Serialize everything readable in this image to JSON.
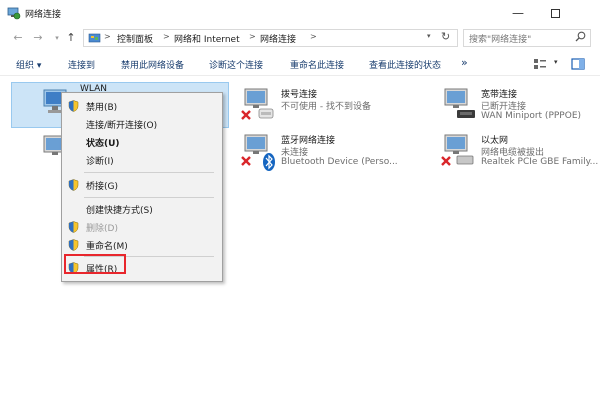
{
  "window": {
    "title": "网络连接",
    "minimize_glyph": "—"
  },
  "nav": {
    "back_glyph": "←",
    "forward_glyph": "→",
    "recent_glyph": "▾",
    "up_glyph": "↑"
  },
  "address": {
    "crumbs": [
      "控制面板",
      "网络和 Internet",
      "网络连接"
    ],
    "separator": ">",
    "dropdown_glyph": "▾",
    "refresh_glyph": "↻"
  },
  "search": {
    "placeholder": "搜索\"网络连接\""
  },
  "commands": {
    "organize": "组织 ▾",
    "connect_to": "连接到",
    "disable_device": "禁用此网络设备",
    "diagnose": "诊断这个连接",
    "rename": "重命名此连接",
    "view_status": "查看此连接的状态",
    "more": "»",
    "view_dropdown_glyph": "▾"
  },
  "connections": [
    {
      "name": "WLAN",
      "status": "",
      "device": ""
    },
    {
      "name": "拨号连接",
      "status": "不可使用 - 找不到设备",
      "device": ""
    },
    {
      "name": "宽带连接",
      "status": "已断开连接",
      "device": "WAN Miniport (PPPOE)"
    },
    {
      "name": "",
      "status": "",
      "device": ""
    },
    {
      "name": "蓝牙网络连接",
      "status": "未连接",
      "device": "Bluetooth Device (Perso..."
    },
    {
      "name": "以太网",
      "status": "网络电缆被拔出",
      "device": "Realtek PCIe GBE Family..."
    }
  ],
  "context_menu": {
    "items": [
      {
        "label": "禁用(B)",
        "shield": true,
        "bold": false,
        "disabled": false
      },
      {
        "label": "连接/断开连接(O)",
        "shield": false,
        "bold": false,
        "disabled": false
      },
      {
        "label": "状态(U)",
        "shield": false,
        "bold": true,
        "disabled": false
      },
      {
        "label": "诊断(I)",
        "shield": false,
        "bold": false,
        "disabled": false
      },
      {
        "label": "桥接(G)",
        "shield": true,
        "bold": false,
        "disabled": false
      },
      {
        "label": "创建快捷方式(S)",
        "shield": false,
        "bold": false,
        "disabled": false
      },
      {
        "label": "删除(D)",
        "shield": true,
        "bold": false,
        "disabled": true
      },
      {
        "label": "重命名(M)",
        "shield": true,
        "bold": false,
        "disabled": false
      },
      {
        "label": "属性(R)",
        "shield": true,
        "bold": false,
        "disabled": false
      }
    ],
    "highlighted_item": "属性(R)"
  },
  "colors": {
    "selection_bg": "#cce4f7",
    "highlight_box": "#e8262c",
    "command_text": "#1a3e6f",
    "error_x": "#d9252a",
    "bluetooth": "#1565c0"
  }
}
